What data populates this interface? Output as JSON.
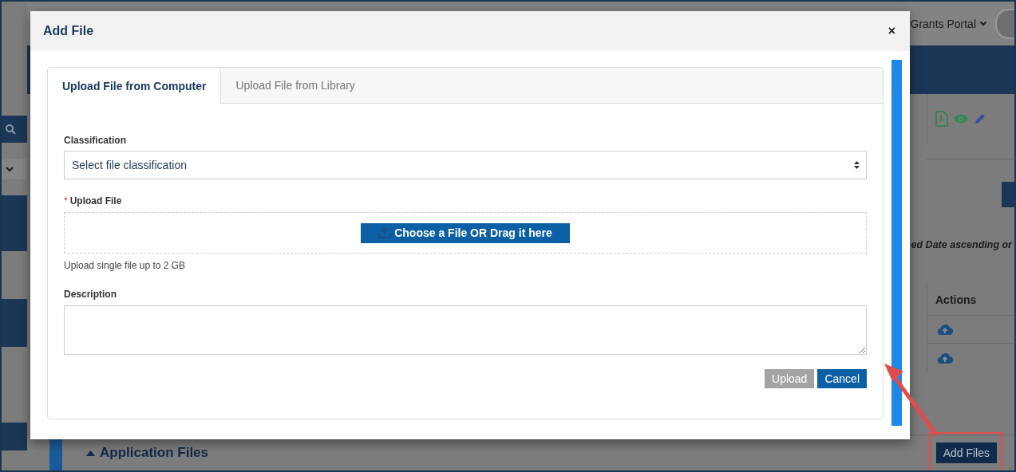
{
  "page": {
    "portal_menu": "Grants Portal",
    "sort_note": "ed Date ascending or",
    "table": {
      "columns": [
        "Actions"
      ]
    },
    "section": {
      "title": "Application Files",
      "expanded": true
    },
    "add_button": "Add Files"
  },
  "dialog": {
    "title": "Add File",
    "close": "×",
    "tabs": [
      {
        "label": "Upload File from Computer",
        "selected": true
      },
      {
        "label": "Upload File from Library",
        "selected": false
      }
    ],
    "classification": {
      "label": "Classification",
      "value": "Select file classification"
    },
    "upload": {
      "required_mark": "*",
      "label": "Upload File",
      "button": "Choose a File OR Drag it here",
      "hint": "Upload single file up to 2 GB"
    },
    "description": {
      "label": "Description"
    },
    "buttons": [
      {
        "label": "Upload",
        "disabled": true
      },
      {
        "label": "Cancel",
        "disabled": false
      }
    ]
  }
}
